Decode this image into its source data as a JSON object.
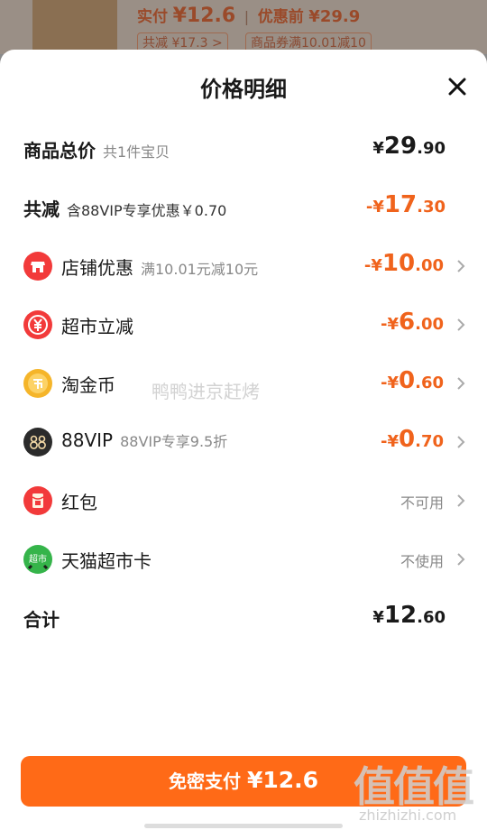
{
  "background": {
    "paid_label": "实付",
    "paid_amount": "¥12.6",
    "separator": "|",
    "original_label": "优惠前",
    "original_amount": "¥29.9",
    "tag_total_reduce": "共减 ¥17.3 >",
    "tag_coupon": "商品券满10.01减10"
  },
  "sheet": {
    "title": "价格明细",
    "close_icon": "close-icon",
    "rows": [
      {
        "label": "商品总价",
        "sub": "共1件宝贝",
        "cur": "¥",
        "int": "29",
        "dec": ".90"
      },
      {
        "label": "共减",
        "sub": "含88VIP专享优惠￥0.70",
        "cur": "-¥",
        "int": "17",
        "dec": ".30"
      },
      {
        "label": "店铺优惠",
        "sub": "满10.01元减10元",
        "cur": "-¥",
        "int": "10",
        "dec": ".00",
        "icon": "shop-icon"
      },
      {
        "label": "超市立减",
        "cur": "-¥",
        "int": "6",
        "dec": ".00",
        "icon": "yen-discount-icon"
      },
      {
        "label": "淘金币",
        "cur": "-¥",
        "int": "0",
        "dec": ".60",
        "icon": "coin-icon"
      },
      {
        "label": "88VIP",
        "sub": "88VIP专享9.5折",
        "cur": "-¥",
        "int": "0",
        "dec": ".70",
        "icon": "vip-88-icon"
      },
      {
        "label": "红包",
        "status": "不可用",
        "icon": "red-packet-icon"
      },
      {
        "label": "天猫超市卡",
        "status": "不使用",
        "icon": "supermarket-card-icon",
        "icon_text": "超市"
      },
      {
        "label": "合计",
        "cur": "¥",
        "int": "12",
        "dec": ".60"
      }
    ]
  },
  "watermark": "鸭鸭进京赶烤",
  "pay_button": {
    "label": "免密支付",
    "amount": "¥12.6"
  },
  "site_logo": "值值值",
  "site_url": "zhizhizhi.com",
  "colors": {
    "accent_orange": "#ff6a17",
    "discount_orange": "#f0631c",
    "shop_red": "#f23a3a",
    "coin_gold": "#f5b52a",
    "vip_dark": "#2b2b2b",
    "tmall_green": "#35b44a"
  }
}
